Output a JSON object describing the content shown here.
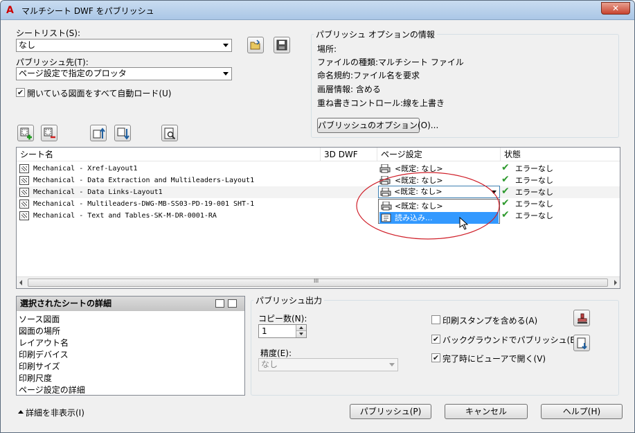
{
  "window": {
    "title": "マルチシート DWF をパブリッシュ",
    "close_label": "✕"
  },
  "sheet_list": {
    "label": "シートリスト(S):",
    "value": "なし"
  },
  "publish_to": {
    "label": "パブリッシュ先(T):",
    "value": "ページ設定で指定のプロッタ"
  },
  "auto_load": {
    "label": "開いている図面をすべて自動ロード(U)",
    "checked": true
  },
  "publish_options_info": {
    "title": "パブリッシュ オプションの情報",
    "location": "場所:",
    "file_type": "ファイルの種類:マルチシート ファイル",
    "naming": "命名規約:ファイル名を要求",
    "layer_info": "画層情報: 含める",
    "merge_control": "重ね書きコントロール:線を上書き",
    "options_button": "パブリッシュのオプション(O)..."
  },
  "table": {
    "columns": [
      "シート名",
      "3D DWF",
      "ページ設定",
      "状態"
    ],
    "rows": [
      {
        "name": "Mechanical - Xref-Layout1",
        "page_setup": "<既定: なし>",
        "status": "エラーなし"
      },
      {
        "name": "Mechanical - Data Extraction and Multileaders-Layout1",
        "page_setup": "<既定: なし>",
        "status": "エラーなし"
      },
      {
        "name": "Mechanical - Data Links-Layout1",
        "page_setup": "<既定: なし>",
        "status": "エラーなし"
      },
      {
        "name": "Mechanical - Multileaders-DWG-MB-SS03-PD-19-001 SHT-1",
        "page_setup": "<既定: なし>",
        "status": "エラーなし"
      },
      {
        "name": "Mechanical - Text and Tables-SK-M-DR-0001-RA",
        "page_setup": "",
        "status": "エラーなし"
      }
    ],
    "dropdown": {
      "current": "<既定: なし>",
      "options": [
        "<既定: なし>",
        "読み込み..."
      ]
    },
    "scroll_marker": "III"
  },
  "details": {
    "title": "選択されたシートの詳細",
    "items": [
      "ソース図面",
      "図面の場所",
      "レイアウト名",
      "印刷デバイス",
      "印刷サイズ",
      "印刷尺度",
      "ページ設定の詳細"
    ]
  },
  "publish_output": {
    "title": "パブリッシュ出力",
    "copies_label": "コピー数(N):",
    "copies_value": "1",
    "precision_label": "精度(E):",
    "precision_value": "なし",
    "stamp_label": "印刷スタンプを含める(A)",
    "stamp_checked": false,
    "background_label": "バックグラウンドでパブリッシュ(B)",
    "background_checked": true,
    "viewer_label": "完了時にビューアで開く(V)",
    "viewer_checked": true
  },
  "footer": {
    "hide_details": "詳細を非表示(I)",
    "publish": "パブリッシュ(P)",
    "cancel": "キャンセル",
    "help": "ヘルプ(H)"
  },
  "colors": {
    "check_green": "#2e9a2e",
    "highlight": "#3399ff",
    "annotation_red": "#d0202a"
  }
}
